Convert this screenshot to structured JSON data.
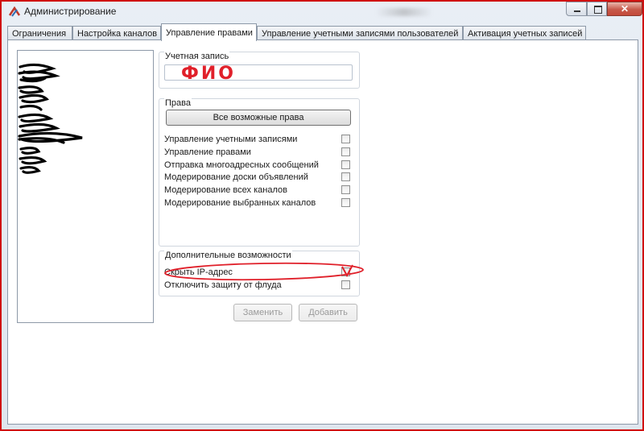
{
  "window": {
    "title": "Администрирование",
    "close_glyph": "✕"
  },
  "tabs": [
    {
      "label": "Ограничения"
    },
    {
      "label": "Настройка каналов"
    },
    {
      "label": "Управление правами"
    },
    {
      "label": "Управление учетными записями пользователей"
    },
    {
      "label": "Активация учетных записей"
    }
  ],
  "active_tab": "Управление правами",
  "account": {
    "legend": "Учетная запись",
    "value": "ФИО"
  },
  "rights": {
    "legend": "Права",
    "all_rights_button": "Все возможные права",
    "items": [
      {
        "label": "Управление учетными записями",
        "checked": false
      },
      {
        "label": "Управление правами",
        "checked": false
      },
      {
        "label": "Отправка многоадресных сообщений",
        "checked": false
      },
      {
        "label": "Модерирование доски объявлений",
        "checked": false
      },
      {
        "label": "Модерирование всех каналов",
        "checked": false
      },
      {
        "label": "Модерирование выбранных каналов",
        "checked": false
      }
    ]
  },
  "extra": {
    "legend": "Дополнительные возможности",
    "items": [
      {
        "label": "Скрыть IP-адрес",
        "checked": false
      },
      {
        "label": "Отключить защиту от флуда",
        "checked": false
      }
    ]
  },
  "actions": {
    "replace": "Заменить",
    "add": "Добавить"
  },
  "colors": {
    "annotation": "#e0202a",
    "frame": "#d01010"
  }
}
